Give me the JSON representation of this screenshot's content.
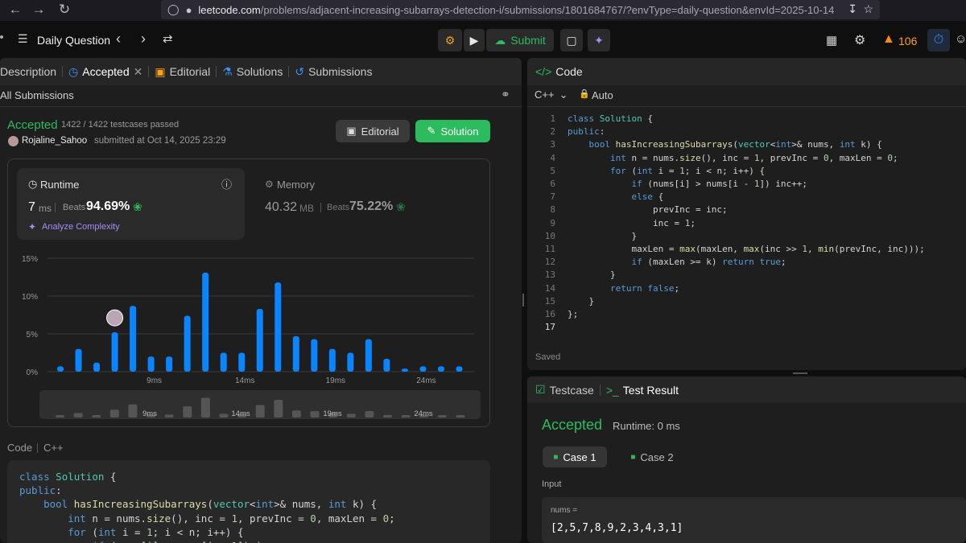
{
  "browser": {
    "url_domain": "leetcode.com",
    "url_path": "/problems/adjacent-increasing-subarrays-detection-i/submissions/1801684767/?envType=daily-question&envId=2025-10-14"
  },
  "topnav": {
    "daily_question": "Daily Question",
    "submit_label": "Submit",
    "streak_count": "106"
  },
  "left_tabs": {
    "description": "Description",
    "accepted": "Accepted",
    "editorial": "Editorial",
    "solutions": "Solutions",
    "submissions": "Submissions"
  },
  "all_submissions": "All Submissions",
  "result": {
    "status": "Accepted",
    "testcases": "1422 / 1422 testcases passed",
    "user": "Rojaline_Sahoo",
    "submitted_at": "submitted at Oct 14, 2025 23:29",
    "editorial_btn": "Editorial",
    "solution_btn": "Solution"
  },
  "runtime": {
    "label": "Runtime",
    "value": "7",
    "unit": "ms",
    "beats_label": "Beats",
    "beats": "94.69%",
    "analyze": "Analyze Complexity"
  },
  "memory": {
    "label": "Memory",
    "value": "40.32",
    "unit": "MB",
    "beats_label": "Beats",
    "beats": "75.22%"
  },
  "chart_data": {
    "type": "bar",
    "title": "",
    "xlabel": "",
    "ylabel": "",
    "ylim": [
      0,
      15
    ],
    "yticks": [
      "0%",
      "5%",
      "10%",
      "15%"
    ],
    "xticks": [
      {
        "label": "9ms",
        "at": 5
      },
      {
        "label": "14ms",
        "at": 10
      },
      {
        "label": "19ms",
        "at": 15
      },
      {
        "label": "24ms",
        "at": 20
      }
    ],
    "values": [
      0.7,
      3.0,
      1.2,
      5.2,
      8.7,
      2.0,
      2.0,
      7.4,
      13.1,
      2.5,
      2.5,
      8.3,
      11.8,
      4.7,
      4.3,
      3.0,
      2.5,
      4.3,
      1.7,
      0.4,
      0.7,
      0.7,
      0.7
    ],
    "user_bar_index": 3,
    "mini_xticks": [
      "9ms",
      "14ms",
      "19ms",
      "24ms"
    ],
    "bar_color": "#0a84ff"
  },
  "bottom_code": {
    "header_code": "Code",
    "header_lang": "C++"
  },
  "code_panel": {
    "title": "Code",
    "lang": "C++",
    "auto": "Auto",
    "saved": "Saved"
  },
  "code_lines": [
    "class Solution {",
    "public:",
    "    bool hasIncreasingSubarrays(vector<int>& nums, int k) {",
    "        int n = nums.size(), inc = 1, prevInc = 0, maxLen = 0;",
    "        for (int i = 1; i < n; i++) {",
    "            if (nums[i] > nums[i - 1]) inc++;",
    "            else {",
    "                prevInc = inc;",
    "                inc = 1;",
    "            }",
    "            maxLen = max(maxLen, max(inc >> 1, min(prevInc, inc)));",
    "            if (maxLen >= k) return true;",
    "        }",
    "        return false;",
    "    }",
    "};",
    ""
  ],
  "testpanel": {
    "testcase_tab": "Testcase",
    "result_tab": "Test Result",
    "status": "Accepted",
    "runtime": "Runtime: 0 ms",
    "case1": "Case 1",
    "case2": "Case 2",
    "input_label": "Input",
    "var_name": "nums =",
    "var_value": "[2,5,7,8,9,2,3,4,3,1]"
  }
}
